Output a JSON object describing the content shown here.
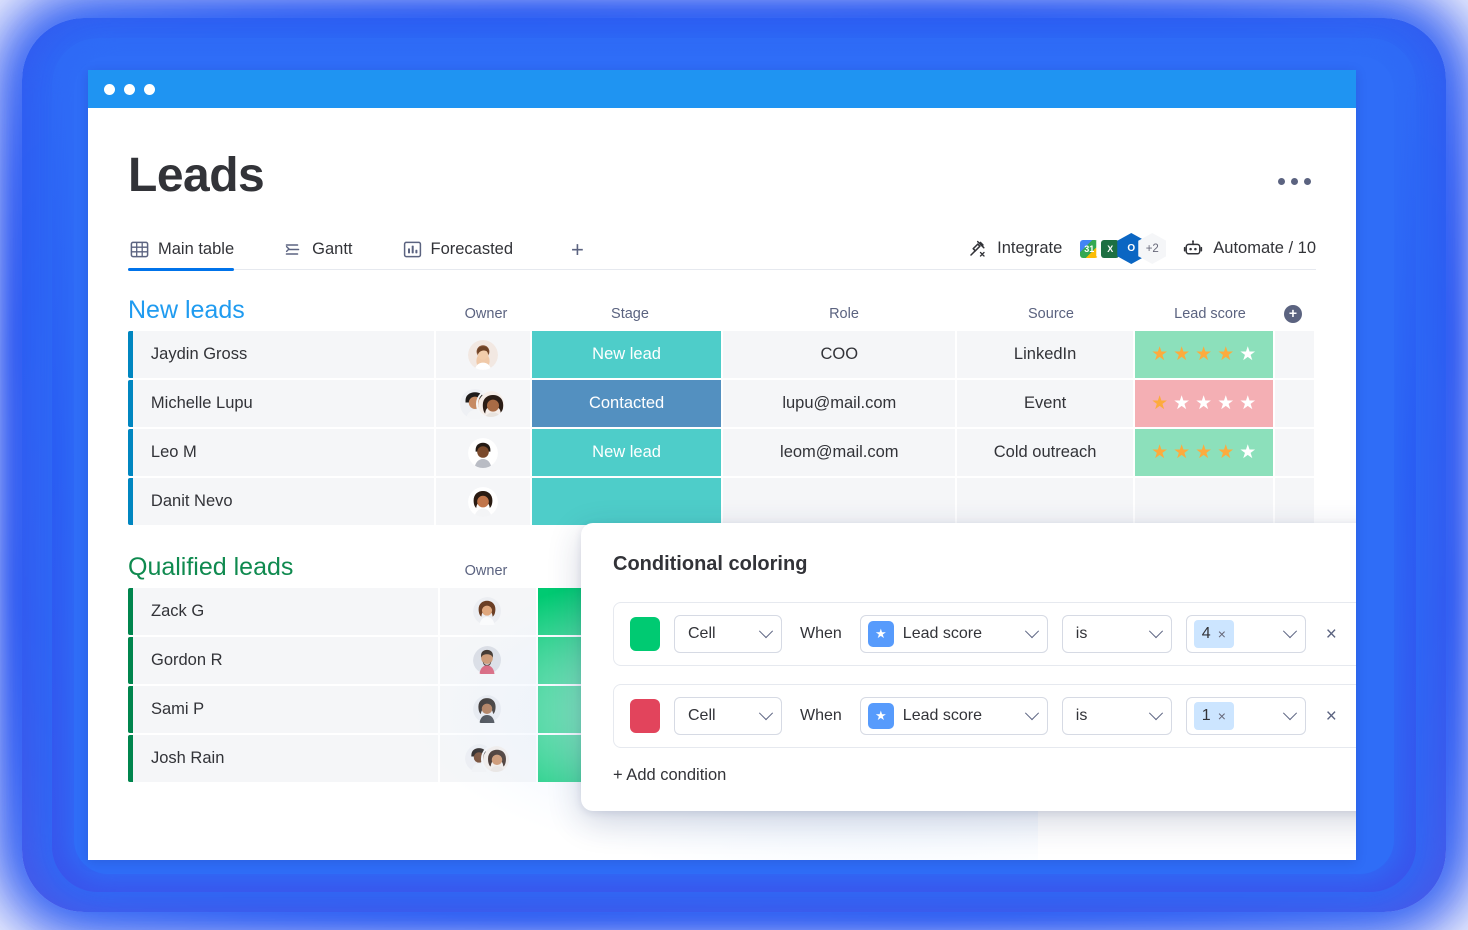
{
  "window": {
    "titlebar_color": "#1f94f2",
    "dots": 3
  },
  "header": {
    "title": "Leads",
    "more_menu": "..."
  },
  "tabs": [
    {
      "label": "Main table",
      "icon": "table-grid-icon",
      "active": true
    },
    {
      "label": "Gantt",
      "icon": "gantt-icon",
      "active": false
    },
    {
      "label": "Forecasted",
      "icon": "bar-chart-icon",
      "active": false
    }
  ],
  "tab_add_label": "+",
  "toolbar": {
    "integrate_label": "Integrate",
    "integrate_icon": "plug-icon",
    "integrations": [
      {
        "name": "google-calendar",
        "glyph": "31"
      },
      {
        "name": "excel",
        "glyph": "X"
      },
      {
        "name": "outlook",
        "glyph": "O"
      }
    ],
    "integrations_overflow": "+2",
    "automate_label": "Automate / 10",
    "automate_icon": "robot-icon"
  },
  "groups": [
    {
      "name": "New leads",
      "color": "#1f9bf0",
      "accent": "#0086c0",
      "columns": [
        "",
        "Owner",
        "Stage",
        "Role",
        "Source",
        "Lead score"
      ],
      "rows": [
        {
          "name": "Jaydin Gross",
          "owner": "single",
          "stage": {
            "label": "New lead",
            "color": "#4ecdc9"
          },
          "role": "COO",
          "source": "LinkedIn",
          "score": 4,
          "score_bg": "#8ce0bb"
        },
        {
          "name": "Michelle Lupu",
          "owner": "pair",
          "stage": {
            "label": "Contacted",
            "color": "#5390c0"
          },
          "role": "lupu@mail.com",
          "source": "Event",
          "score": 1,
          "score_bg": "#f4afb4"
        },
        {
          "name": "Leo M",
          "owner": "single",
          "stage": {
            "label": "New lead",
            "color": "#4ecdc9"
          },
          "role": "leom@mail.com",
          "source": "Cold outreach",
          "score": 4,
          "score_bg": "#8ce0bb"
        },
        {
          "name": "Danit Nevo",
          "owner": "single",
          "stage": {
            "label": "",
            "color": "#4ecdc9"
          },
          "role": "",
          "source": "",
          "score": 0,
          "score_bg": "#f5f6f8"
        }
      ]
    },
    {
      "name": "Qualified leads",
      "color": "#0f8a4f",
      "accent": "#00854d",
      "columns": [
        "",
        "Owner"
      ],
      "rows": [
        {
          "name": "Zack G",
          "owner": "single",
          "stage": {
            "label": "",
            "color": "#00ca72"
          }
        },
        {
          "name": "Gordon R",
          "owner": "single",
          "stage": {
            "label": "",
            "color": "#00ca72"
          }
        },
        {
          "name": "Sami P",
          "owner": "single",
          "stage": {
            "label": "",
            "color": "#00ca72"
          }
        },
        {
          "name": "Josh Rain",
          "owner": "pair",
          "stage": {
            "label": "",
            "color": "#00ca72"
          }
        }
      ]
    }
  ],
  "add_column_label": "+",
  "panel": {
    "title": "Conditional coloring",
    "when_label": "When",
    "add_condition_label": "+ Add condition",
    "conditions": [
      {
        "color": "#00ca72",
        "target": "Cell",
        "column": "Lead score",
        "column_icon": "star-icon",
        "operator": "is",
        "value": "4",
        "value_remove": "×",
        "remove_label": "×"
      },
      {
        "color": "#e2445c",
        "target": "Cell",
        "column": "Lead score",
        "column_icon": "star-icon",
        "operator": "is",
        "value": "1",
        "value_remove": "×",
        "remove_label": "×"
      }
    ]
  }
}
